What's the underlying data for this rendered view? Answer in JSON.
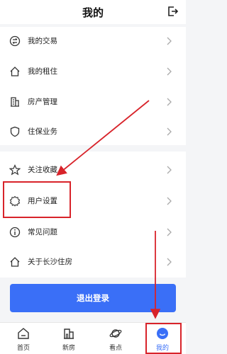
{
  "header": {
    "title": "我的",
    "logout_icon": "logout-icon"
  },
  "menu_group_1": [
    {
      "label": "我的交易",
      "icon": "trade-icon"
    },
    {
      "label": "我的租住",
      "icon": "house-icon"
    },
    {
      "label": "房产管理",
      "icon": "building-icon"
    },
    {
      "label": "住保业务",
      "icon": "shield-icon"
    }
  ],
  "menu_group_2": [
    {
      "label": "关注收藏",
      "icon": "star-icon"
    },
    {
      "label": "用户设置",
      "icon": "gear-icon"
    },
    {
      "label": "常见问题",
      "icon": "info-icon"
    },
    {
      "label": "关于长沙住房",
      "icon": "house-icon"
    }
  ],
  "logout_button": {
    "label": "退出登录"
  },
  "tabbar": {
    "tabs": [
      {
        "label": "首页",
        "icon": "home-icon"
      },
      {
        "label": "新房",
        "icon": "building-icon"
      },
      {
        "label": "看点",
        "icon": "planet-icon"
      },
      {
        "label": "我的",
        "icon": "profile-icon",
        "active": true
      }
    ]
  },
  "colors": {
    "accent": "#3a6ff7",
    "annotation": "#d8232a"
  }
}
